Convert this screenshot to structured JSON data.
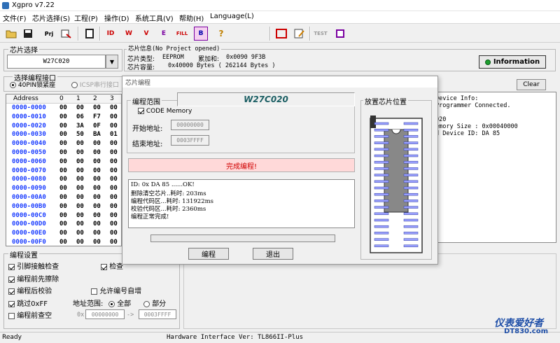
{
  "app": {
    "title": "Xgpro v7.22"
  },
  "menu": [
    "文件(F)",
    "芯片选择(S)",
    "工程(P)",
    "操作(D)",
    "系统工具(V)",
    "帮助(H)",
    "Language(L)"
  ],
  "toolbar": {
    "buttons": [
      "open",
      "save",
      "project",
      "load-project",
      "chip-info",
      "read",
      "write",
      "verify",
      "erase",
      "fill",
      "blank",
      "hint",
      "config",
      "edit",
      "test",
      "ic"
    ]
  },
  "chip_select": {
    "title": "芯片选择",
    "value": "W27C020"
  },
  "chip_info": {
    "title": "芯片信息(No Project opened)",
    "type_label": "芯片类型:",
    "type_value": "EEPROM",
    "checksum_label": "累加和:",
    "checksum_value": "0x0090 9F3B",
    "capacity_label": "芯片容量:",
    "capacity_value": "0x40000 Bytes ( 262144 Bytes )"
  },
  "interface": {
    "title": "选择编程接口",
    "opt1": "40PIN锁紧座",
    "opt2": "ICSP串行接口"
  },
  "hex": {
    "headers": [
      "Address",
      "0",
      "1",
      "2",
      "3"
    ],
    "rows": [
      {
        "addr": "0000-0000",
        "b": [
          "00",
          "00",
          "00",
          "00"
        ]
      },
      {
        "addr": "0000-0010",
        "b": [
          "00",
          "06",
          "F7",
          "00"
        ]
      },
      {
        "addr": "0000-0020",
        "b": [
          "00",
          "3A",
          "0F",
          "00"
        ]
      },
      {
        "addr": "0000-0030",
        "b": [
          "00",
          "50",
          "BA",
          "01"
        ]
      },
      {
        "addr": "0000-0040",
        "b": [
          "00",
          "00",
          "00",
          "00"
        ]
      },
      {
        "addr": "0000-0050",
        "b": [
          "00",
          "00",
          "00",
          "00"
        ]
      },
      {
        "addr": "0000-0060",
        "b": [
          "00",
          "00",
          "00",
          "00"
        ]
      },
      {
        "addr": "0000-0070",
        "b": [
          "00",
          "00",
          "00",
          "00"
        ]
      },
      {
        "addr": "0000-0080",
        "b": [
          "00",
          "00",
          "00",
          "00"
        ]
      },
      {
        "addr": "0000-0090",
        "b": [
          "00",
          "00",
          "00",
          "00"
        ]
      },
      {
        "addr": "0000-00A0",
        "b": [
          "00",
          "00",
          "00",
          "00"
        ]
      },
      {
        "addr": "0000-00B0",
        "b": [
          "00",
          "00",
          "00",
          "00"
        ]
      },
      {
        "addr": "0000-00C0",
        "b": [
          "00",
          "00",
          "00",
          "00"
        ]
      },
      {
        "addr": "0000-00D0",
        "b": [
          "00",
          "00",
          "00",
          "00"
        ]
      },
      {
        "addr": "0000-00E0",
        "b": [
          "00",
          "00",
          "00",
          "00"
        ]
      },
      {
        "addr": "0000-00F0",
        "b": [
          "00",
          "00",
          "00",
          "00"
        ]
      }
    ]
  },
  "info_button": "Information",
  "clear_button": "Clear",
  "log": [
    "Device Info:",
    " Programmer Connected.",
    "",
    "020",
    "emory Size : 0x00040000",
    "d Device ID: DA 85"
  ],
  "settings": {
    "title": "编程设置",
    "opt_pin_check": "引脚接触检查",
    "opt_check_id": "检查",
    "opt_erase_before": "编程前先擦除",
    "opt_verify_after": "编程后校验",
    "opt_auto_inc": "允许编号自增",
    "opt_skip_ff": "跳过0xFF",
    "range_label": "地址范围:",
    "range_all": "全部",
    "range_part": "部分",
    "opt_blank_check": "编程前查空",
    "from_prefix": "0x",
    "from_value": "00000000",
    "to_arrow": "->",
    "to_value": "0003FFFF"
  },
  "status": {
    "left": "Ready",
    "center": "Hardware Interface Ver: TL866II-Plus"
  },
  "watermark": {
    "line1": "仪表爱好者",
    "line2": "DT830.com"
  },
  "dialog": {
    "title": "芯片编程",
    "range_title": "编程范围",
    "chip_name": "W27C020",
    "code_memory": "CODE Memory",
    "start_label": "开始地址:",
    "start_value": "00000000",
    "end_label": "结束地址:",
    "end_value": "0003FFFF",
    "status_text": "完成编程!",
    "log": [
      "ID: 0x DA 85 ......OK!",
      "删除清空芯片..耗时: 203ms",
      "编程代码区...耗时: 131922ms",
      "校验代码区...耗时: 2360ms",
      "编程正常完成!"
    ],
    "progress": 0,
    "program_button": "编程",
    "exit_button": "退出",
    "socket_title": "放置芯片位置"
  }
}
